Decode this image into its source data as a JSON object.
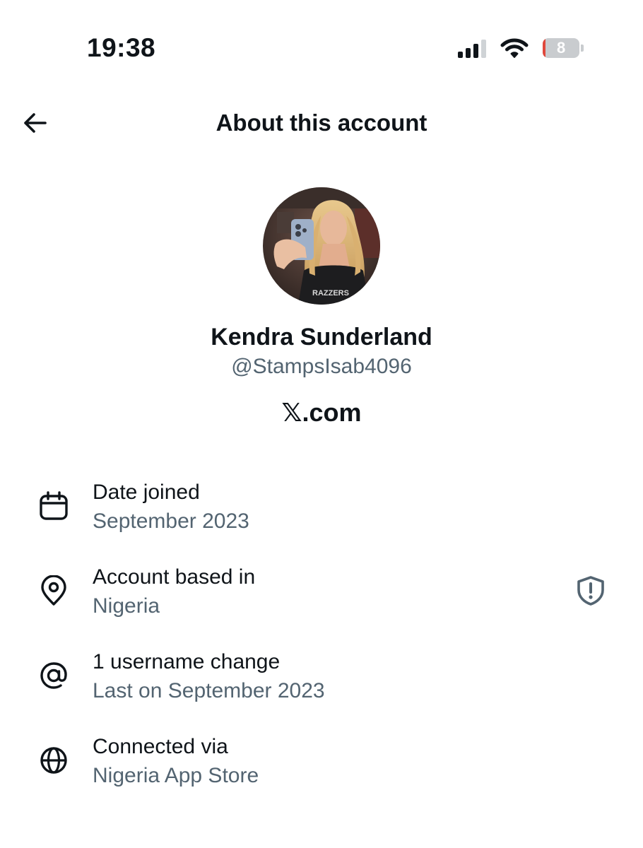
{
  "status_bar": {
    "time": "19:38",
    "battery_level": "8",
    "battery_fraction": 0.08,
    "battery_color": "#e0483c",
    "icons": [
      "cellular-signal-icon",
      "wifi-icon",
      "battery-icon"
    ]
  },
  "header": {
    "title": "About this account",
    "back_icon": "arrow-left-icon"
  },
  "profile": {
    "display_name": "Kendra Sunderland",
    "handle": "@StampsIsab4096",
    "site": "𝕏.com",
    "avatar_shirt_text": "RAZZERS"
  },
  "info": [
    {
      "icon": "calendar-icon",
      "title": "Date joined",
      "value": "September 2023"
    },
    {
      "icon": "location-pin-icon",
      "title": "Account based in",
      "value": "Nigeria",
      "action_icon": "shield-alert-icon"
    },
    {
      "icon": "at-sign-icon",
      "title": "1 username change",
      "value": "Last on September 2023"
    },
    {
      "icon": "globe-icon",
      "title": "Connected via",
      "value": "Nigeria App Store"
    }
  ],
  "colors": {
    "text_primary": "#0f1419",
    "text_secondary": "#536471"
  }
}
